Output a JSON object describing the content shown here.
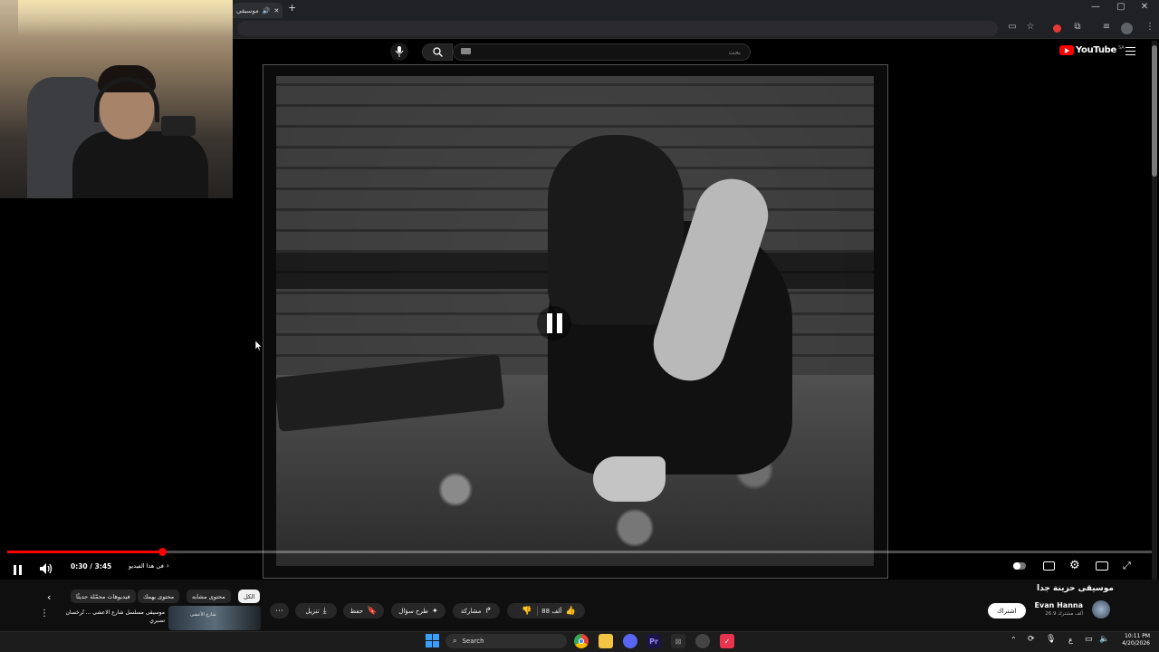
{
  "browser": {
    "tab_title": "موسيقى",
    "new_tab": "+",
    "window_controls": {
      "minimize": "—",
      "maximize": "▢",
      "close": "✕"
    }
  },
  "youtube": {
    "logo_text": "YouTube",
    "region": "SA",
    "search_placeholder": "بحث"
  },
  "player": {
    "time": "0:30 / 3:45",
    "chapter": "في هذا الفيديو",
    "progress": 0.135,
    "state": "paused"
  },
  "video": {
    "title": "موسيقى حزينة جدا",
    "channel": "Evan Hanna",
    "subscribers": "26.9 ألف مشترك",
    "subscribe_label": "اشتراك",
    "likes": "88 ألف",
    "share_label": "مشاركة",
    "ask_label": "طرح سؤال",
    "save_label": "حفظ",
    "download_label": "تنزيل"
  },
  "chips": [
    "الكل",
    "محتوى مشابه",
    "محتوى يهمك",
    "فيديوهات محمّلة حديثًا"
  ],
  "recommendation": {
    "title_line1": "موسيقى مسلسل شارع الاعشى ... تُرخسان",
    "title_line2": "تصبري",
    "thumb_text": "شارع الأعشى"
  },
  "taskbar": {
    "search": "Search",
    "time": "10:11 PM",
    "date": "4/20/2026",
    "lang": "ع"
  },
  "colors": {
    "accent": "#ff0000",
    "chrome_bg": "#202124",
    "yt_bg": "#0f0f0f"
  }
}
